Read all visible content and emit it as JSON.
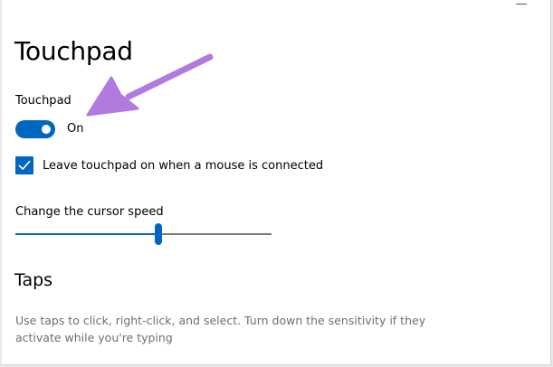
{
  "page": {
    "title": "Touchpad"
  },
  "touchpad_toggle": {
    "label": "Touchpad",
    "state_text": "On",
    "is_on": true
  },
  "mouse_checkbox": {
    "label": "Leave touchpad on when a mouse is connected",
    "checked": true
  },
  "cursor_speed": {
    "label": "Change the cursor speed",
    "value_fraction": 0.56
  },
  "taps": {
    "title": "Taps",
    "description_line1": "Use taps to click, right-click, and select. Turn down the sensitivity if they",
    "description_line2": "activate while you're typing"
  },
  "colors": {
    "accent": "#0067c0",
    "annotation_arrow": "#b07ae0"
  },
  "icons": {
    "checkmark": "checkmark-icon",
    "annotation": "annotation-arrow-icon"
  }
}
